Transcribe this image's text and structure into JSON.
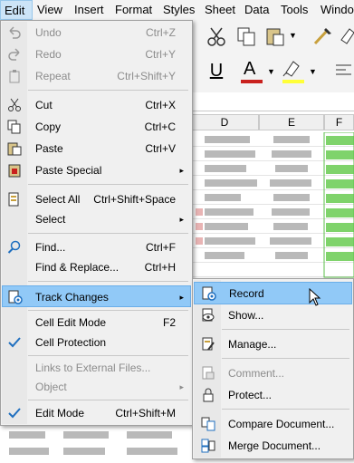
{
  "menubar": {
    "items": [
      "Edit",
      "View",
      "Insert",
      "Format",
      "Styles",
      "Sheet",
      "Data",
      "Tools",
      "Window"
    ],
    "active_index": 0
  },
  "columns": [
    "D",
    "E",
    "F"
  ],
  "edit_menu": {
    "items": [
      {
        "label": "Undo",
        "shortcut": "Ctrl+Z",
        "icon": "undo-icon",
        "enabled": false
      },
      {
        "label": "Redo",
        "shortcut": "Ctrl+Y",
        "icon": "redo-icon",
        "enabled": false
      },
      {
        "label": "Repeat",
        "shortcut": "Ctrl+Shift+Y",
        "icon": "repeat-icon",
        "enabled": false
      },
      {
        "label": "Cut",
        "shortcut": "Ctrl+X",
        "icon": "scissors-icon",
        "enabled": true
      },
      {
        "label": "Copy",
        "shortcut": "Ctrl+C",
        "icon": "copy-icon",
        "enabled": true
      },
      {
        "label": "Paste",
        "shortcut": "Ctrl+V",
        "icon": "paste-icon",
        "enabled": true
      },
      {
        "label": "Paste Special",
        "shortcut": "",
        "icon": "paste-special-icon",
        "enabled": true,
        "submenu": true
      },
      {
        "label": "Select All",
        "shortcut": "Ctrl+Shift+Space",
        "icon": "select-all-icon",
        "enabled": true
      },
      {
        "label": "Select",
        "shortcut": "",
        "enabled": true,
        "submenu": true
      },
      {
        "label": "Find...",
        "shortcut": "Ctrl+F",
        "icon": "search-icon",
        "enabled": true
      },
      {
        "label": "Find & Replace...",
        "shortcut": "Ctrl+H",
        "enabled": true
      },
      {
        "label": "Track Changes",
        "shortcut": "",
        "icon": "track-changes-icon",
        "enabled": true,
        "submenu": true,
        "highlighted": true
      },
      {
        "label": "Cell Edit Mode",
        "shortcut": "F2",
        "enabled": true
      },
      {
        "label": "Cell Protection",
        "shortcut": "",
        "icon": "checkmark-icon",
        "enabled": true,
        "checked": true
      },
      {
        "label": "Links to External Files...",
        "shortcut": "",
        "enabled": false
      },
      {
        "label": "Object",
        "shortcut": "",
        "enabled": false,
        "submenu": true
      },
      {
        "label": "Edit Mode",
        "shortcut": "Ctrl+Shift+M",
        "icon": "checkmark-icon",
        "enabled": true,
        "checked": true
      }
    ]
  },
  "track_changes_menu": {
    "items": [
      {
        "label": "Record",
        "icon": "record-changes-icon",
        "enabled": true,
        "highlighted": true
      },
      {
        "label": "Show...",
        "icon": "show-changes-icon",
        "enabled": true
      },
      {
        "label": "Manage...",
        "icon": "manage-changes-icon",
        "enabled": true
      },
      {
        "label": "Comment...",
        "icon": "comment-icon",
        "enabled": false
      },
      {
        "label": "Protect...",
        "icon": "lock-icon",
        "enabled": true
      },
      {
        "label": "Compare Document...",
        "icon": "compare-document-icon",
        "enabled": true
      },
      {
        "label": "Merge Document...",
        "icon": "merge-document-icon",
        "enabled": true
      }
    ]
  }
}
